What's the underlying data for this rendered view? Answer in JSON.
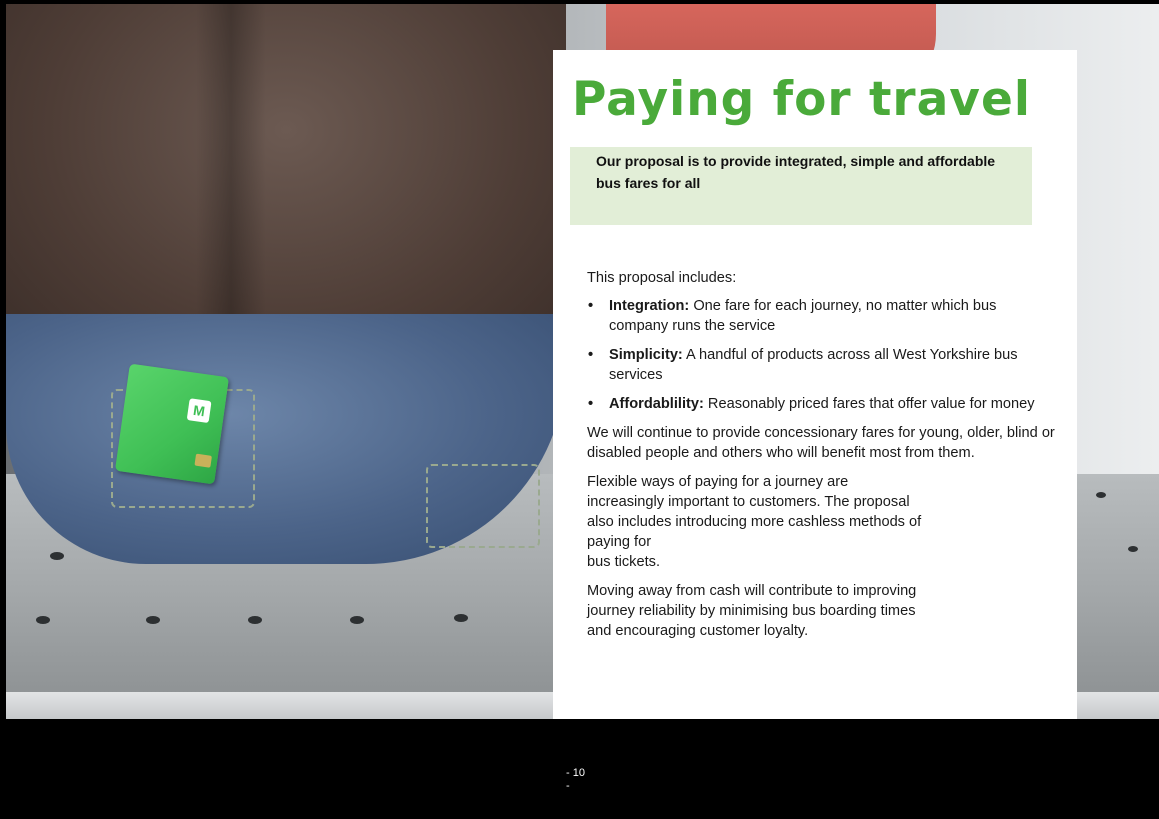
{
  "title": "Paying for travel",
  "highlight": "Our proposal is to provide integrated, simple and affordable bus fares for all",
  "intro": "This proposal includes:",
  "bullets": [
    {
      "term": "Integration:",
      "text": "One fare for each journey, no matter which bus company runs the service"
    },
    {
      "term": "Simplicity:",
      "text": "A handful of products across all West Yorkshire bus services"
    },
    {
      "term": "Affordablility:",
      "text": "Reasonably priced fares that offer value for money"
    }
  ],
  "paragraphs": {
    "concessionary": "We will continue to provide concessionary fares for young, older, blind or disabled people and others who will benefit most from them.",
    "flexible": [
      "Flexible ways of paying for a journey are",
      "increasingly important to customers. The proposal",
      "also includes introducing more cashless methods of",
      "paying for",
      "bus tickets."
    ],
    "cash": [
      "Moving away from cash will contribute to improving",
      "journey reliability by minimising bus boarding times",
      "and encouraging customer loyalty."
    ]
  },
  "page_number": {
    "line1": "- 10",
    "line2": "-"
  },
  "colors": {
    "title_green": "#4aaa3a",
    "highlight_bg": "#e2eed7",
    "footer_bg": "#000000"
  }
}
